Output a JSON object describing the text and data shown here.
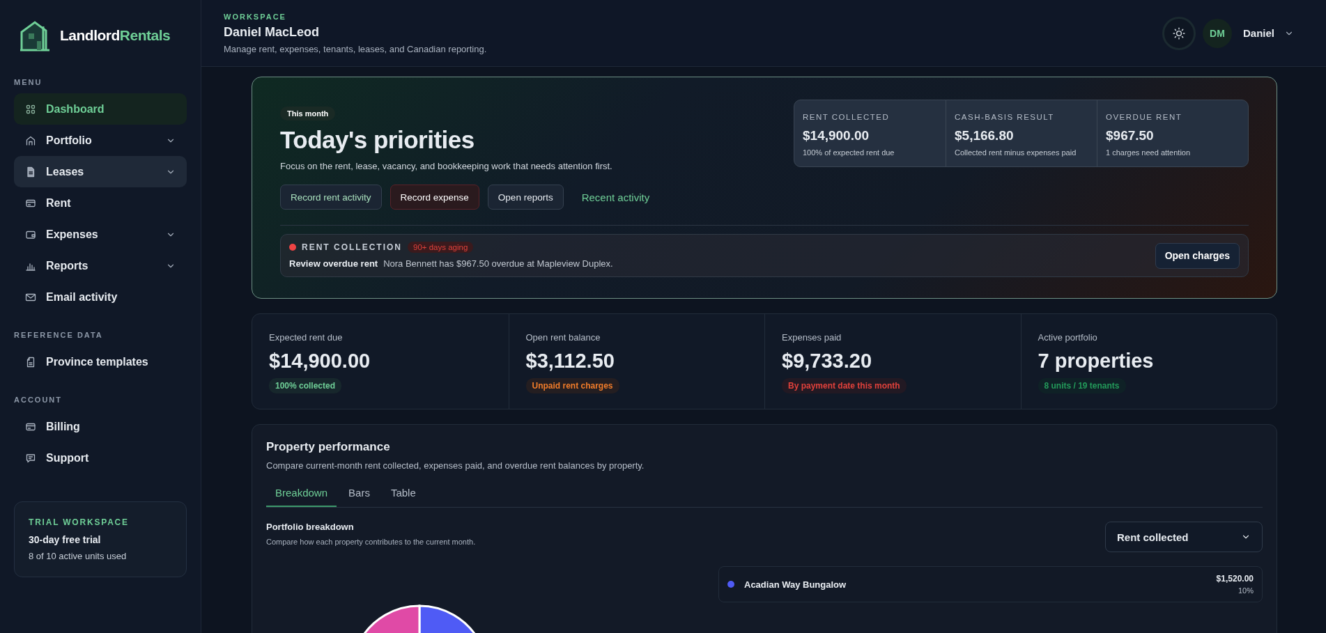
{
  "brand": {
    "name_main": "Landlord",
    "name_accent": "Rentals"
  },
  "sidebar": {
    "sections": [
      {
        "heading": "MENU",
        "items": [
          {
            "label": "Dashboard",
            "selected": true,
            "hovered": false,
            "expandable": false
          },
          {
            "label": "Portfolio",
            "selected": false,
            "hovered": false,
            "expandable": true
          },
          {
            "label": "Leases",
            "selected": false,
            "hovered": true,
            "expandable": true
          },
          {
            "label": "Rent",
            "selected": false,
            "hovered": false,
            "expandable": false
          },
          {
            "label": "Expenses",
            "selected": false,
            "hovered": false,
            "expandable": true
          },
          {
            "label": "Reports",
            "selected": false,
            "hovered": false,
            "expandable": true
          },
          {
            "label": "Email activity",
            "selected": false,
            "hovered": false,
            "expandable": false
          }
        ]
      },
      {
        "heading": "REFERENCE DATA",
        "items": [
          {
            "label": "Province templates",
            "selected": false,
            "hovered": false,
            "expandable": false
          }
        ]
      },
      {
        "heading": "ACCOUNT",
        "items": [
          {
            "label": "Billing",
            "selected": false,
            "hovered": false,
            "expandable": false
          },
          {
            "label": "Support",
            "selected": false,
            "hovered": false,
            "expandable": false
          }
        ]
      }
    ],
    "trial": {
      "label": "TRIAL WORKSPACE",
      "title": "30-day free trial",
      "usage": "8 of 10 active units used"
    }
  },
  "header": {
    "eyebrow": "WORKSPACE",
    "title": "Daniel MacLeod",
    "subtitle": "Manage rent, expenses, tenants, leases, and Canadian reporting.",
    "user": {
      "initials": "DM",
      "name": "Daniel"
    }
  },
  "hero": {
    "chip": "This month",
    "title": "Today's priorities",
    "description": "Focus on the rent, lease, vacancy, and bookkeeping work that needs attention first.",
    "actions": [
      {
        "label": "Record rent activity",
        "kind": "primary"
      },
      {
        "label": "Record expense",
        "kind": "danger"
      },
      {
        "label": "Open reports",
        "kind": "neutral"
      },
      {
        "label": "Recent activity",
        "kind": "link"
      }
    ],
    "metrics": [
      {
        "label": "RENT COLLECTED",
        "value": "$14,900.00",
        "note": "100% of expected rent due"
      },
      {
        "label": "CASH-BASIS RESULT",
        "value": "$5,166.80",
        "note": "Collected rent minus expenses paid"
      },
      {
        "label": "OVERDUE RENT",
        "value": "$967.50",
        "note": "1 charges need attention"
      }
    ],
    "alert": {
      "color": "#ef4444",
      "category": "RENT COLLECTION",
      "tag": "90+ days aging",
      "title": "Review overdue rent",
      "message": "Nora Bennett has $967.50 overdue at Mapleview Duplex.",
      "button": "Open charges"
    }
  },
  "stats": [
    {
      "label": "Expected rent due",
      "value": "$14,900.00",
      "badge": "100% collected",
      "color": "#6fcf97"
    },
    {
      "label": "Open rent balance",
      "value": "$3,112.50",
      "badge": "Unpaid rent charges",
      "color": "#f07c2a"
    },
    {
      "label": "Expenses paid",
      "value": "$9,733.20",
      "badge": "By payment date this month",
      "color": "#e0413b"
    },
    {
      "label": "Active portfolio",
      "value": "7 properties",
      "badge": "8 units / 19 tenants",
      "color": "#239a5a"
    }
  ],
  "performance": {
    "title": "Property performance",
    "description": "Compare current-month rent collected, expenses paid, and overdue rent balances by property.",
    "tabs": [
      {
        "label": "Breakdown",
        "selected": true
      },
      {
        "label": "Bars",
        "selected": false
      },
      {
        "label": "Table",
        "selected": false
      }
    ],
    "breakdown": {
      "title": "Portfolio breakdown",
      "description": "Compare how each property contributes to the current month.",
      "metric_select": "Rent collected",
      "legend": [
        {
          "name": "Acadian Way Bungalow",
          "color": "#4f5bf5",
          "amount": "$1,520.00",
          "share": "10%"
        }
      ]
    }
  }
}
